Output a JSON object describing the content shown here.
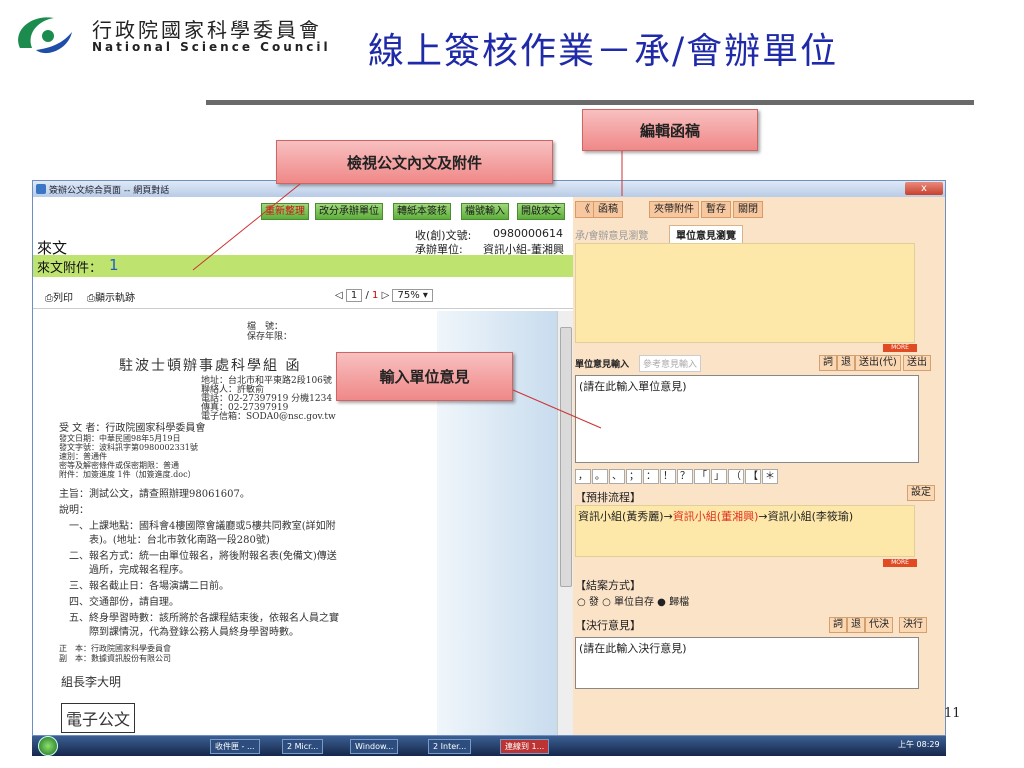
{
  "slide": {
    "org_cn": "行政院國家科學委員會",
    "org_en": "National Science Council",
    "title": "線上簽核作業－承/會辦單位",
    "page_number": "11"
  },
  "callouts": {
    "edit": "編輯函稿",
    "view": "檢視公文內文及附件",
    "opinion": "輸入單位意見"
  },
  "window": {
    "title": "簽辦公文綜合頁面 -- 網頁對話",
    "close": "x"
  },
  "left": {
    "buttons": [
      "重新整理",
      "改分承辦單位",
      "轉紙本簽核",
      "檔號輸入",
      "開啟來文"
    ],
    "doc_no_label": "收(創)文號:",
    "doc_no_value": "0980000614",
    "unit_label": "承辦單位:",
    "unit_value": "資訊小組-董湘興",
    "incoming_label": "來文",
    "attach_label": "來文附件：",
    "attach_count": "1",
    "print": "列印",
    "track": "顯示軌跡",
    "page_current": "1",
    "page_total": "1",
    "zoom": "75%"
  },
  "doc": {
    "head": "駐波士頓辦事處科學組 函",
    "head_meta": [
      "檔　號：",
      "保存年限："
    ],
    "addr": [
      "地址：台北市和平東路2段106號",
      "聯絡人：許敏俞",
      "電話：02-27397919 分機1234",
      "傳真：02-27397919",
      "電子信箱：SODA0@nsc.gov.tw"
    ],
    "recipient": "受 文 者：行政院國家科學委員會",
    "meta": [
      "發文日期：中華民國98年5月19日",
      "發文字號：波科訊字第0980002331號",
      "速別：普通件",
      "密等及解密條件或保密期限：普通",
      "附件：加簽進度 1件（加簽進度.doc）"
    ],
    "subject": "主旨：測試公文，請查照辦理98061607。",
    "explain": "說明：",
    "items": [
      "一、上課地點：國科會4樓國際會議廳或5樓共同教室(詳如附",
      "　　表)。(地址：台北市敦化南路一段280號)",
      "二、報名方式：統一由單位報名，將後附報名表(免備文)傳送",
      "　　過所，完成報名程序。",
      "三、報名截止日：各場演講二日前。",
      "四、交通部份，請自理。",
      "五、終身學習時數：該所將於各課程結束後，依報名人員之實",
      "　　際到課情況，代為登錄公務人員終身學習時數。"
    ],
    "cc": [
      "正　本：行政院國家科學委員會",
      "副　本：數據資訊股份有限公司"
    ],
    "signature": "組長李大明",
    "e_doc": "電子公文"
  },
  "right": {
    "tabs": [
      "《",
      "函稿",
      "夾帶附件",
      "暫存",
      "關閉"
    ],
    "subtab_other": "承/會辦意見瀏覽",
    "subtab_active": "單位意見瀏覽",
    "more": "MORE",
    "op_input_label": "單位意見輸入",
    "op_ref_label": "參考意見輸入",
    "btn_words": "詞",
    "btn_back": "退",
    "btn_send_proxy": "送出(代)",
    "btn_send": "送出",
    "op_placeholder": "(請在此輸入單位意見)",
    "punctuation": [
      "，",
      "。",
      "、",
      "；",
      "：",
      "！",
      "？",
      "「",
      "」",
      "（",
      "【",
      "＊"
    ],
    "flow_label": "【預排流程】",
    "btn_set": "設定",
    "flow_a": "資訊小組(黃秀麗)→",
    "flow_b": "資訊小組(董湘興)",
    "flow_c": "→資訊小組(李筱瑜)",
    "close_label": "【結案方式】",
    "close_options": "○ 發 ○ 單位自存 ● 歸檔",
    "decision_label": "【決行意見】",
    "btn_decide_proxy": "代決",
    "btn_decide": "決行",
    "decision_placeholder": "(請在此輸入決行意見)",
    "colors": {
      "pane_bg": "#fbe3c8",
      "box_bg": "#fde8a9",
      "highlight": "#e03020"
    }
  },
  "taskbar": {
    "tasks": [
      "收件匣 - ...",
      "2 Micr...",
      "Window...",
      "2 Inter...",
      "連線到 1..."
    ],
    "clock": "上午 08:29"
  }
}
